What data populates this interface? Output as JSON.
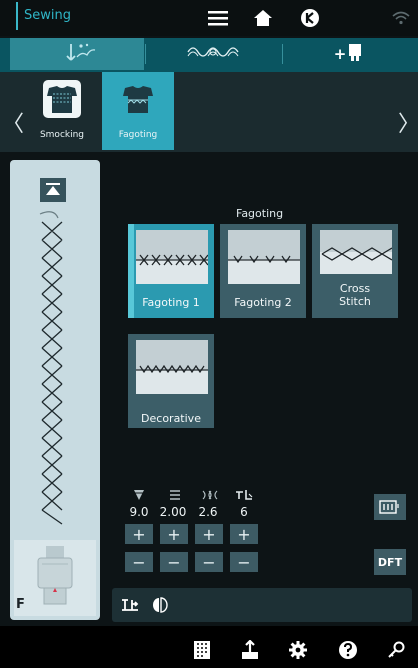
{
  "app": {
    "mode_title": "Sewing"
  },
  "topbar": {
    "icons": [
      "menu-icon",
      "home-icon",
      "jklockoff-icon",
      "wifi-icon"
    ]
  },
  "tabs": {
    "items": [
      {
        "icon": "embroidery-stitch-icon",
        "active": true
      },
      {
        "icon": "decorative-stitch-icon",
        "active": false
      },
      {
        "icon": "add-foot-icon",
        "active": false
      }
    ],
    "add_label": "+"
  },
  "groups": {
    "items": [
      {
        "label": "Smocking",
        "icon": "smocking-garment-icon",
        "active": false
      },
      {
        "label": "Fagoting",
        "icon": "fagoting-garment-icon",
        "active": true
      }
    ],
    "prev": "〈",
    "next": "〉"
  },
  "main": {
    "section_title": "Fagoting",
    "tiles": [
      {
        "label": "Fagoting 1",
        "active": true
      },
      {
        "label": "Fagoting 2",
        "active": false
      },
      {
        "label": "Cross\nStitch",
        "active": false
      },
      {
        "label": "Decorative",
        "active": false
      }
    ]
  },
  "left_panel": {
    "presser_foot_letter": "F"
  },
  "params": [
    {
      "name": "width",
      "icon": "stitch-width-icon",
      "value": "9.0",
      "plus": "+",
      "minus": "−"
    },
    {
      "name": "length",
      "icon": "stitch-length-icon",
      "value": "2.00",
      "plus": "+",
      "minus": "−"
    },
    {
      "name": "density",
      "icon": "stitch-density-icon",
      "value": "2.6",
      "plus": "+",
      "minus": "−"
    },
    {
      "name": "tension",
      "icon": "thread-tension-icon",
      "value": "6",
      "plus": "+",
      "minus": "−"
    }
  ],
  "right_buttons": {
    "counter_icon": "stitch-counter-icon",
    "dft_label": "DFT"
  },
  "bottom_nav": {
    "icons": [
      "stitch-menu-icon",
      "export-icon",
      "settings-icon",
      "help-icon",
      "tools-icon"
    ]
  },
  "colors": {
    "accent": "#2fb6c7",
    "active_tile": "#2b9ab0",
    "tile": "#3c5e68",
    "panel": "#c8dbe1"
  }
}
